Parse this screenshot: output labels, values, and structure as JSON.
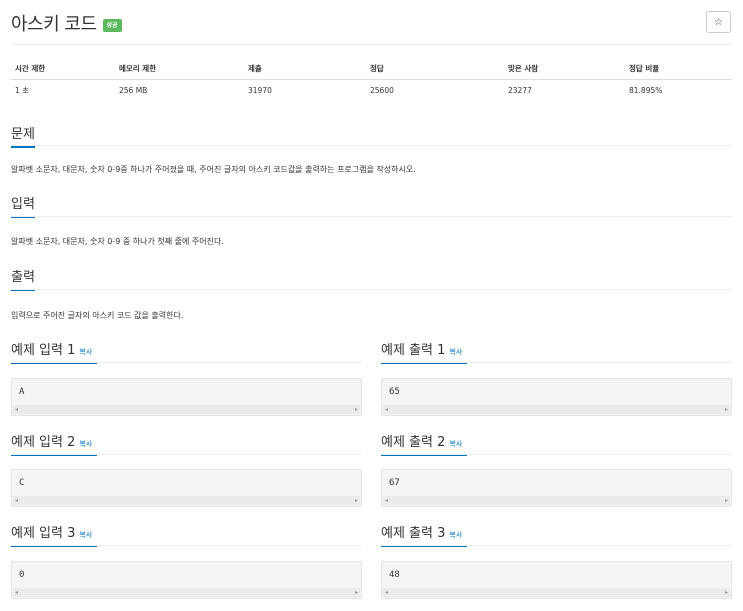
{
  "problem": {
    "title": "아스키 코드",
    "status_badge": "성공",
    "star_icon": "☆"
  },
  "info_table": {
    "headers": [
      "시간 제한",
      "메모리 제한",
      "제출",
      "정답",
      "맞은 사람",
      "정답 비율"
    ],
    "values": [
      "1 초",
      "256 MB",
      "31970",
      "25600",
      "23277",
      "81.895%"
    ]
  },
  "sections": {
    "problem_heading": "문제",
    "problem_text": "알파벳 소문자, 대문자, 숫자 0-9중 하나가 주어졌을 때, 주어진 글자의 아스키 코드값을 출력하는 프로그램을 작성하시오.",
    "input_heading": "입력",
    "input_text": "알파벳 소문자, 대문자, 숫자 0-9 중 하나가 첫째 줄에 주어진다.",
    "output_heading": "출력",
    "output_text": "입력으로 주어진 글자의 아스키 코드 값을 출력한다."
  },
  "examples": [
    {
      "input_title": "예제 입력 1",
      "output_title": "예제 출력 1",
      "copy_label": "복사",
      "input": "A",
      "output": "65"
    },
    {
      "input_title": "예제 입력 2",
      "output_title": "예제 출력 2",
      "copy_label": "복사",
      "input": "C",
      "output": "67"
    },
    {
      "input_title": "예제 입력 3",
      "output_title": "예제 출력 3",
      "copy_label": "복사",
      "input": "0",
      "output": "48"
    }
  ],
  "scroll_arrows": {
    "left": "◂",
    "right": "▸"
  }
}
